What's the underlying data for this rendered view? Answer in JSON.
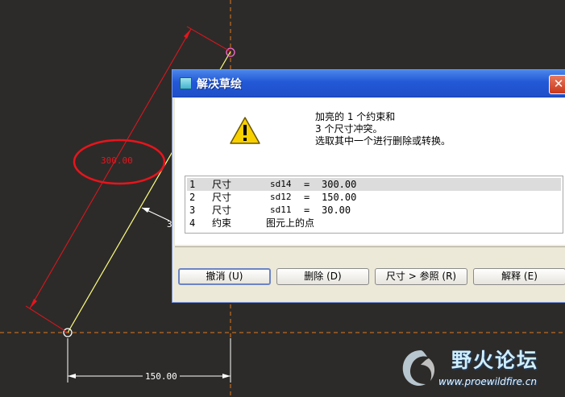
{
  "sketch": {
    "dim_300": "300.00",
    "dim_150": "150.00",
    "dim_30_partial": "3"
  },
  "dialog": {
    "title": "解决草绘",
    "close_glyph": "✕",
    "message": "加亮的 1 个约束和\n3 个尺寸冲突。\n选取其中一个进行删除或转换。",
    "conflicts": [
      {
        "index": "1",
        "type": "尺寸",
        "name": "sd14",
        "eq": "=",
        "value": "300.00",
        "selected": true
      },
      {
        "index": "2",
        "type": "尺寸",
        "name": "sd12",
        "eq": "=",
        "value": "150.00",
        "selected": false
      },
      {
        "index": "3",
        "type": "尺寸",
        "name": "sd11",
        "eq": "=",
        "value": "30.00",
        "selected": false
      },
      {
        "index": "4",
        "type": "约束",
        "desc": "图元上的点",
        "selected": false
      }
    ],
    "buttons": {
      "undo": "撤消 (U)",
      "delete": "删除 (D)",
      "dim_to_ref": "尺寸 > 参照 (R)",
      "explain": "解释 (E)"
    }
  },
  "watermark": {
    "title": "野火论坛",
    "url": "www.proewildfire.cn"
  },
  "colors": {
    "background": "#2d2b29",
    "dim_line": "#e8141c",
    "geometry": "#ffff80",
    "center_line": "#e07820",
    "annotation": "#e8141c",
    "dialog_title": "#2358d6"
  }
}
